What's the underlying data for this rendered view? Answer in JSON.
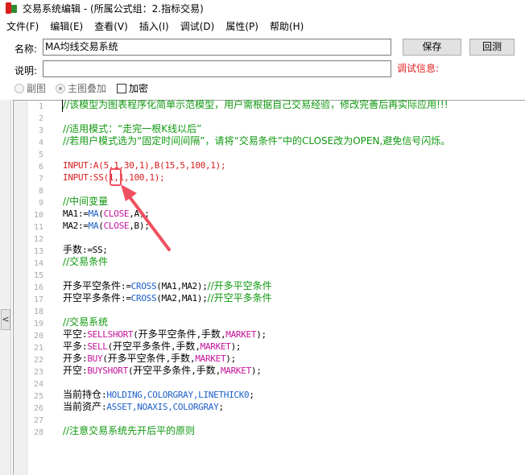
{
  "window": {
    "title": "交易系统编辑 - (所属公式组：2.指标交易)"
  },
  "menu": [
    {
      "label": "文件(F)"
    },
    {
      "label": "编辑(E)"
    },
    {
      "label": "查看(V)"
    },
    {
      "label": "插入(I)"
    },
    {
      "label": "调试(D)"
    },
    {
      "label": "属性(P)"
    },
    {
      "label": "帮助(H)"
    }
  ],
  "form": {
    "name_label": "名称:",
    "name_value": "MA均线交易系统",
    "desc_label": "说明:",
    "desc_value": "",
    "save_label": "保存",
    "back_label": "回测",
    "debug_label": "调试信息:",
    "options": {
      "subchart_label": "副图",
      "overlay_label": "主图叠加",
      "encrypt_label": "加密",
      "overlay_selected": true,
      "encrypt_checked": false
    }
  },
  "sidebar": {
    "toggle_glyph": "<"
  },
  "editor": {
    "line_numbers": [
      "1",
      "2",
      "3",
      "4",
      "5",
      "6",
      "7",
      "8",
      "9",
      "10",
      "11",
      "12",
      "13",
      "14",
      "15",
      "16",
      "17",
      "18",
      "19",
      "20",
      "21",
      "22",
      "23",
      "24",
      "25",
      "26",
      "27",
      "28"
    ],
    "lines": {
      "l1": "//该模型为图表程序化简单示范模型，用户需根据自己交易经验，修改完善后再实际应用!!!",
      "l3": "//适用模式：“走完一根K线以后”",
      "l4": "//若用户模式选为“固定时间间隔”，请将“交易条件”中的CLOSE改为OPEN,避免信号闪烁。",
      "l6": "INPUT:A(5,1,30,1),B(15,5,100,1);",
      "l7": "INPUT:SS(1,1,100,1);",
      "l9": "//中间变量",
      "l10_a": "MA1:=",
      "l10_fn": "MA",
      "l10_b": "(",
      "l10_c": "CLOSE",
      "l10_d": ",A);",
      "l11_a": "MA2:=",
      "l11_fn": "MA",
      "l11_b": "(",
      "l11_c": "CLOSE",
      "l11_d": ",B);",
      "l13_a": "手数",
      "l13_b": ":=SS;",
      "l14": "//交易条件",
      "l16_a": "开多平空条件",
      "l16_b": ":=",
      "l16_fn": "CROSS",
      "l16_c": "(MA1,MA2);",
      "l16_d": "//开多平空条件",
      "l17_a": "开空平多条件",
      "l17_b": ":=",
      "l17_fn": "CROSS",
      "l17_c": "(MA2,MA1);",
      "l17_d": "//开空平多条件",
      "l19": "//交易系统",
      "l20_a": "平空",
      "l20_b": ":",
      "l20_fn": "SELLSHORT",
      "l20_c": "(",
      "l20_d": "开多平空条件",
      "l20_e": ",",
      "l20_f": "手数",
      "l20_g": ",",
      "l20_h": "MARKET",
      "l20_i": ");",
      "l21_a": "平多",
      "l21_b": ":",
      "l21_fn": "SELL",
      "l21_c": "(",
      "l21_d": "开空平多条件",
      "l21_e": ",",
      "l21_f": "手数",
      "l21_g": ",",
      "l21_h": "MARKET",
      "l21_i": ");",
      "l22_a": "开多",
      "l22_b": ":",
      "l22_fn": "BUY",
      "l22_c": "(",
      "l22_d": "开多平空条件",
      "l22_e": ",",
      "l22_f": "手数",
      "l22_g": ",",
      "l22_h": "MARKET",
      "l22_i": ");",
      "l23_a": "开空",
      "l23_b": ":",
      "l23_fn": "BUYSHORT",
      "l23_c": "(",
      "l23_d": "开空平多条件",
      "l23_e": ",",
      "l23_f": "手数",
      "l23_g": ",",
      "l23_h": "MARKET",
      "l23_i": ");",
      "l25_a": "当前持仓",
      "l25_b": ":",
      "l25_c": "HOLDING,COLORGRAY,LINETHICK0",
      "l25_d": ";",
      "l26_a": "当前资产",
      "l26_b": ":",
      "l26_c": "ASSET,NOAXIS,COLORGRAY",
      "l26_d": ";",
      "l28": "//注意交易系统先开后平的原则"
    }
  },
  "colors": {
    "comment": "#119911",
    "input": "#d81e1e",
    "function": "#1a5fc8",
    "constant": "#c4129c",
    "annotation": "#f05060"
  }
}
